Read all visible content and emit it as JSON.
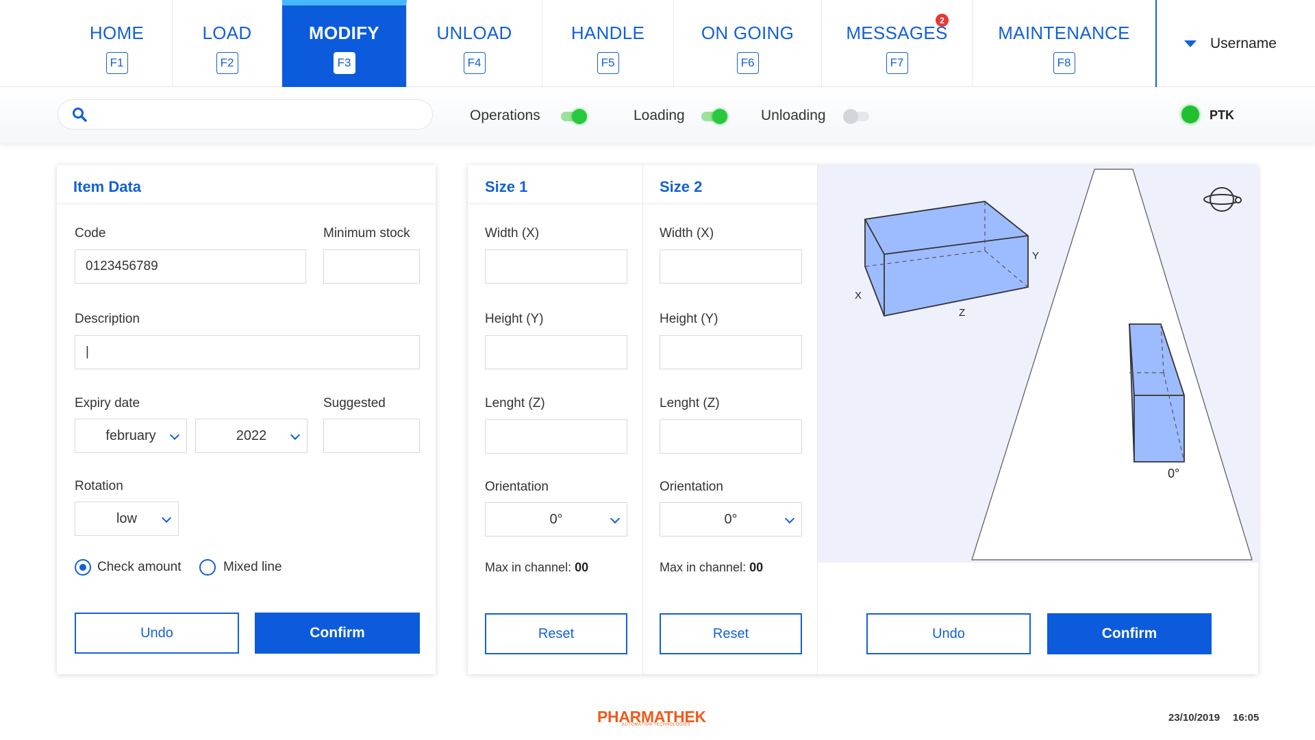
{
  "nav": {
    "tabs": [
      {
        "label": "HOME",
        "key": "F1"
      },
      {
        "label": "LOAD",
        "key": "F2"
      },
      {
        "label": "MODIFY",
        "key": "F3"
      },
      {
        "label": "UNLOAD",
        "key": "F4"
      },
      {
        "label": "HANDLE",
        "key": "F5"
      },
      {
        "label": "ON GOING",
        "key": "F6"
      },
      {
        "label": "MESSAGES",
        "key": "F7",
        "badge": "2"
      },
      {
        "label": "MAINTENANCE",
        "key": "F8"
      }
    ],
    "active_tab": "MODIFY",
    "user": "Username"
  },
  "toolbar": {
    "search_value": "",
    "toggles": [
      {
        "label": "Operations",
        "state": "on"
      },
      {
        "label": "Loading",
        "state": "on"
      },
      {
        "label": "Unloading",
        "state": "off"
      }
    ],
    "status_label": "PTK",
    "status_color": "#20c030"
  },
  "item_data": {
    "title": "Item Data",
    "code_label": "Code",
    "code_value": "0123456789",
    "min_stock_label": "Minimum stock",
    "min_stock_value": "",
    "description_label": "Description",
    "description_value": "|",
    "expiry_label": "Expiry date",
    "expiry_month": "february",
    "expiry_year": "2022",
    "suggested_label": "Suggested",
    "suggested_value": "",
    "rotation_label": "Rotation",
    "rotation_value": "low",
    "check_amount_label": "Check amount",
    "check_amount_checked": true,
    "mixed_line_label": "Mixed line",
    "mixed_line_checked": false,
    "undo_label": "Undo",
    "confirm_label": "Confirm"
  },
  "size1": {
    "title": "Size 1",
    "width_label": "Width (X)",
    "height_label": "Height (Y)",
    "length_label": "Lenght (Z)",
    "orientation_label": "Orientation",
    "orientation_value": "0°",
    "max_label": "Max in channel: ",
    "max_value": "00",
    "reset_label": "Reset"
  },
  "size2": {
    "title": "Size 2",
    "width_label": "Width (X)",
    "height_label": "Height (Y)",
    "length_label": "Lenght (Z)",
    "orientation_label": "Orientation",
    "orientation_value": "0°",
    "max_label": "Max in channel: ",
    "max_value": "00",
    "reset_label": "Reset"
  },
  "preview": {
    "axis_x": "X",
    "axis_y": "Y",
    "axis_z": "Z",
    "angle": "0°",
    "undo_label": "Undo",
    "confirm_label": "Confirm"
  },
  "footer": {
    "brand": "PHARMATHEK",
    "brand_sub": "AUTOMATION TECHNOLOGIES",
    "date": "23/10/2019",
    "time": "16:05"
  },
  "colors": {
    "accent": "#0b5bdc",
    "brand": "#f05a1a",
    "active_tab_top": "#48b7ff"
  }
}
